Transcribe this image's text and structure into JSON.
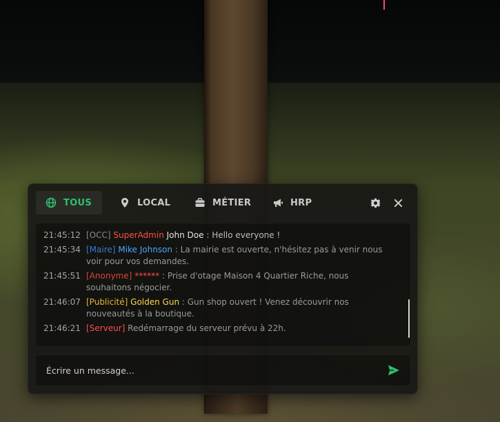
{
  "tabs": [
    {
      "label": "TOUS",
      "icon": "globe-icon",
      "active": true
    },
    {
      "label": "LOCAL",
      "icon": "map-pin-icon",
      "active": false
    },
    {
      "label": "MÉTIER",
      "icon": "briefcase-icon",
      "active": false
    },
    {
      "label": "HRP",
      "icon": "megaphone-icon",
      "active": false
    }
  ],
  "toolbar": {
    "settings_icon": "gear-icon",
    "close_icon": "close-icon"
  },
  "messages": [
    {
      "time": "21:45:12",
      "tag": "[OCC]",
      "tag_color": "#8a8a8a",
      "author": "SuperAdmin",
      "author_color": "#ff4d4d",
      "name": "John Doe",
      "name_color": "#e6e6e6",
      "text": " : Hello everyone !"
    },
    {
      "time": "21:45:34",
      "tag": "[Maire]",
      "tag_color": "#3a7bd5",
      "author": "Mike Johnson",
      "author_color": "#4da3ff",
      "name": "",
      "name_color": "#e6e6e6",
      "text": " : La mairie est ouverte, n'hésitez pas à venir nous voir pour vos demandes."
    },
    {
      "time": "21:45:51",
      "tag": "[Anonyme]",
      "tag_color": "#d9443a",
      "author": "******",
      "author_color": "#ff4d4d",
      "name": "",
      "name_color": "#e6e6e6",
      "text": " : Prise d'otage Maison 4 Quartier Riche, nous souhaitons négocier."
    },
    {
      "time": "21:46:07",
      "tag": "[Publicité]",
      "tag_color": "#e5b73b",
      "author": "Golden Gun",
      "author_color": "#ffd84d",
      "name": "",
      "name_color": "#e6e6e6",
      "text": " : Gun shop ouvert ! Venez découvrir nos nouveautés à la boutique."
    },
    {
      "time": "21:46:21",
      "tag": "[Serveur]",
      "tag_color": "#ff4d4d",
      "author": "",
      "author_color": "#ff4d4d",
      "name": "",
      "name_color": "#e6e6e6",
      "text": " Redémarrage du serveur prévu à 22h."
    }
  ],
  "composer": {
    "placeholder": "Écrire un message...",
    "value": "",
    "send_icon": "send-icon"
  },
  "colors": {
    "accent": "#2fbf71",
    "panel": "#181816"
  }
}
